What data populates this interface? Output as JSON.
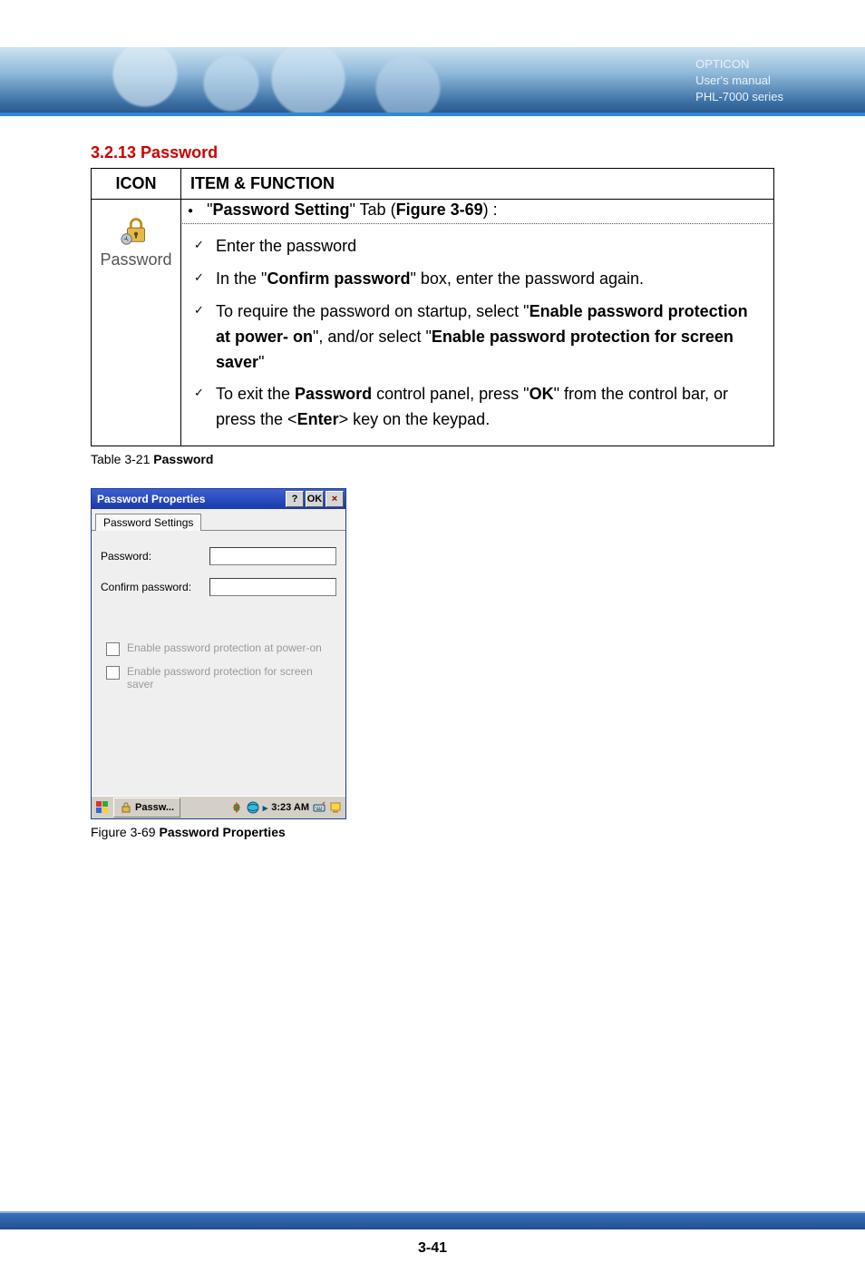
{
  "header": {
    "brand": "OPTICON",
    "line2": "User's manual",
    "line3": "PHL-7000 series"
  },
  "section": {
    "heading": "3.2.13 Password"
  },
  "table": {
    "head_icon": "ICON",
    "head_item": "ITEM & FUNCTION",
    "icon_label": "Password",
    "tab_line_prefix": "\"",
    "tab_line_bold1": "Password Setting",
    "tab_line_mid1": "\" Tab (",
    "tab_line_bold2": "Figure 3-69",
    "tab_line_suffix": ") :",
    "items": {
      "i1": "Enter the password",
      "i2a": "In the \"",
      "i2b": "Confirm password",
      "i2c": "\" box, enter the password again.",
      "i3a": "To require the password on startup, select \"",
      "i3b": "Enable password protection at power- on",
      "i3c": "\", and/or select \"",
      "i3d": "Enable password protection for screen saver",
      "i3e": "\"",
      "i4a": "To exit the ",
      "i4b": "Password",
      "i4c": " control panel, press \"",
      "i4d": "OK",
      "i4e": "\" from the control bar, or press the <",
      "i4f": "Enter",
      "i4g": "> key on the keypad."
    }
  },
  "captions": {
    "table": "Table 3-21 ",
    "table_bold": "Password",
    "figure": "Figure 3-69 ",
    "figure_bold": "Password Properties"
  },
  "window": {
    "title": "Password Properties",
    "help": "?",
    "ok": "OK",
    "close": "×",
    "tab": "Password Settings",
    "lbl_password": "Password:",
    "lbl_confirm": "Confirm password:",
    "chk1": "Enable password protection at power-on",
    "chk2": "Enable password protection for screen saver",
    "task_label": "Passw...",
    "time": "3:23 AM"
  },
  "page_number": "3-41"
}
